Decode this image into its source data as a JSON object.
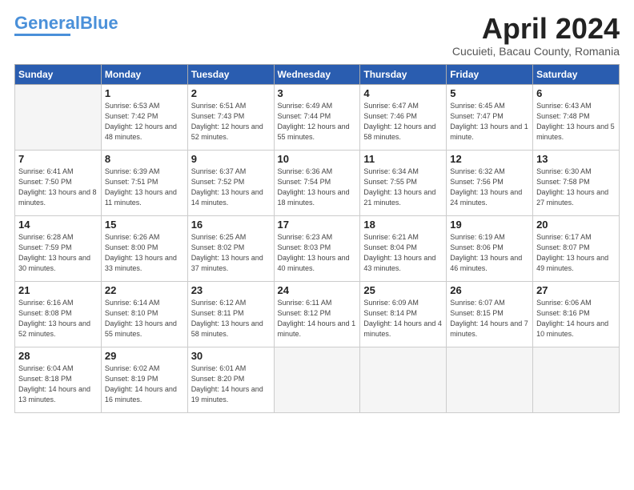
{
  "header": {
    "logo_general": "General",
    "logo_blue": "Blue",
    "month_title": "April 2024",
    "subtitle": "Cucuieti, Bacau County, Romania"
  },
  "days_of_week": [
    "Sunday",
    "Monday",
    "Tuesday",
    "Wednesday",
    "Thursday",
    "Friday",
    "Saturday"
  ],
  "weeks": [
    [
      {
        "day": "",
        "empty": true
      },
      {
        "day": "1",
        "sunrise": "6:53 AM",
        "sunset": "7:42 PM",
        "daylight": "12 hours and 48 minutes."
      },
      {
        "day": "2",
        "sunrise": "6:51 AM",
        "sunset": "7:43 PM",
        "daylight": "12 hours and 52 minutes."
      },
      {
        "day": "3",
        "sunrise": "6:49 AM",
        "sunset": "7:44 PM",
        "daylight": "12 hours and 55 minutes."
      },
      {
        "day": "4",
        "sunrise": "6:47 AM",
        "sunset": "7:46 PM",
        "daylight": "12 hours and 58 minutes."
      },
      {
        "day": "5",
        "sunrise": "6:45 AM",
        "sunset": "7:47 PM",
        "daylight": "13 hours and 1 minute."
      },
      {
        "day": "6",
        "sunrise": "6:43 AM",
        "sunset": "7:48 PM",
        "daylight": "13 hours and 5 minutes."
      }
    ],
    [
      {
        "day": "7",
        "sunrise": "6:41 AM",
        "sunset": "7:50 PM",
        "daylight": "13 hours and 8 minutes."
      },
      {
        "day": "8",
        "sunrise": "6:39 AM",
        "sunset": "7:51 PM",
        "daylight": "13 hours and 11 minutes."
      },
      {
        "day": "9",
        "sunrise": "6:37 AM",
        "sunset": "7:52 PM",
        "daylight": "13 hours and 14 minutes."
      },
      {
        "day": "10",
        "sunrise": "6:36 AM",
        "sunset": "7:54 PM",
        "daylight": "13 hours and 18 minutes."
      },
      {
        "day": "11",
        "sunrise": "6:34 AM",
        "sunset": "7:55 PM",
        "daylight": "13 hours and 21 minutes."
      },
      {
        "day": "12",
        "sunrise": "6:32 AM",
        "sunset": "7:56 PM",
        "daylight": "13 hours and 24 minutes."
      },
      {
        "day": "13",
        "sunrise": "6:30 AM",
        "sunset": "7:58 PM",
        "daylight": "13 hours and 27 minutes."
      }
    ],
    [
      {
        "day": "14",
        "sunrise": "6:28 AM",
        "sunset": "7:59 PM",
        "daylight": "13 hours and 30 minutes."
      },
      {
        "day": "15",
        "sunrise": "6:26 AM",
        "sunset": "8:00 PM",
        "daylight": "13 hours and 33 minutes."
      },
      {
        "day": "16",
        "sunrise": "6:25 AM",
        "sunset": "8:02 PM",
        "daylight": "13 hours and 37 minutes."
      },
      {
        "day": "17",
        "sunrise": "6:23 AM",
        "sunset": "8:03 PM",
        "daylight": "13 hours and 40 minutes."
      },
      {
        "day": "18",
        "sunrise": "6:21 AM",
        "sunset": "8:04 PM",
        "daylight": "13 hours and 43 minutes."
      },
      {
        "day": "19",
        "sunrise": "6:19 AM",
        "sunset": "8:06 PM",
        "daylight": "13 hours and 46 minutes."
      },
      {
        "day": "20",
        "sunrise": "6:17 AM",
        "sunset": "8:07 PM",
        "daylight": "13 hours and 49 minutes."
      }
    ],
    [
      {
        "day": "21",
        "sunrise": "6:16 AM",
        "sunset": "8:08 PM",
        "daylight": "13 hours and 52 minutes."
      },
      {
        "day": "22",
        "sunrise": "6:14 AM",
        "sunset": "8:10 PM",
        "daylight": "13 hours and 55 minutes."
      },
      {
        "day": "23",
        "sunrise": "6:12 AM",
        "sunset": "8:11 PM",
        "daylight": "13 hours and 58 minutes."
      },
      {
        "day": "24",
        "sunrise": "6:11 AM",
        "sunset": "8:12 PM",
        "daylight": "14 hours and 1 minute."
      },
      {
        "day": "25",
        "sunrise": "6:09 AM",
        "sunset": "8:14 PM",
        "daylight": "14 hours and 4 minutes."
      },
      {
        "day": "26",
        "sunrise": "6:07 AM",
        "sunset": "8:15 PM",
        "daylight": "14 hours and 7 minutes."
      },
      {
        "day": "27",
        "sunrise": "6:06 AM",
        "sunset": "8:16 PM",
        "daylight": "14 hours and 10 minutes."
      }
    ],
    [
      {
        "day": "28",
        "sunrise": "6:04 AM",
        "sunset": "8:18 PM",
        "daylight": "14 hours and 13 minutes."
      },
      {
        "day": "29",
        "sunrise": "6:02 AM",
        "sunset": "8:19 PM",
        "daylight": "14 hours and 16 minutes."
      },
      {
        "day": "30",
        "sunrise": "6:01 AM",
        "sunset": "8:20 PM",
        "daylight": "14 hours and 19 minutes."
      },
      {
        "day": "",
        "empty": true
      },
      {
        "day": "",
        "empty": true
      },
      {
        "day": "",
        "empty": true
      },
      {
        "day": "",
        "empty": true
      }
    ]
  ]
}
